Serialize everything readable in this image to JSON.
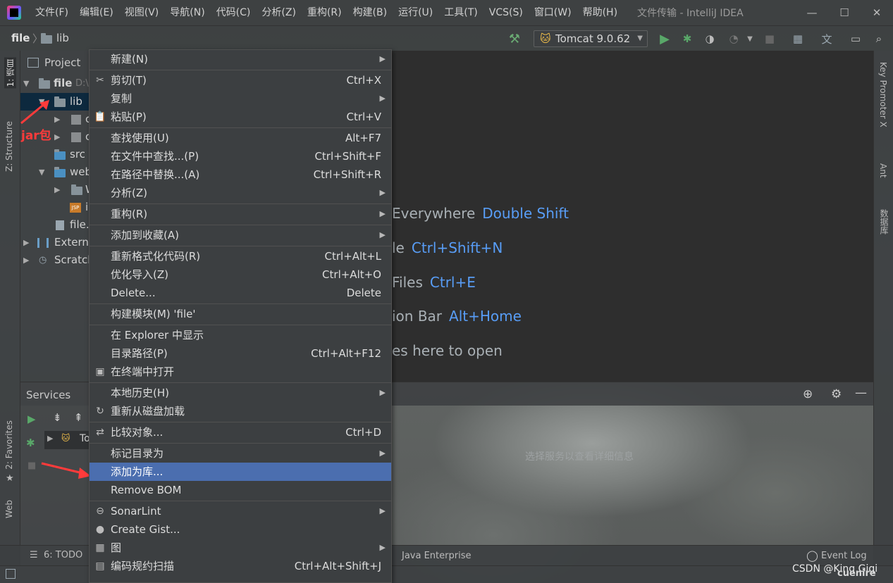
{
  "title_bar": {
    "menus": [
      "文件(F)",
      "编辑(E)",
      "视图(V)",
      "导航(N)",
      "代码(C)",
      "分析(Z)",
      "重构(R)",
      "构建(B)",
      "运行(U)",
      "工具(T)",
      "VCS(S)",
      "窗口(W)",
      "帮助(H)"
    ],
    "window_title": "文件传输 - IntelliJ IDEA",
    "minimize": "—",
    "maximize": "☐",
    "close": "✕"
  },
  "navbar": {
    "crumb_root": "file",
    "crumb_sep": "〉",
    "crumb_folder": "lib",
    "run_config": "Tomcat 9.0.62"
  },
  "left_stripe": {
    "tab_project": "1: 项目",
    "tab_structure": "Z: Structure",
    "tab_favorites": "2: Favorites",
    "tab_web": "Web"
  },
  "right_stripe": {
    "tab_key_promoter": "Key Promoter X",
    "tab_ant": "Ant",
    "tab_database": "数据库"
  },
  "project_panel": {
    "header": "Project",
    "tree": [
      {
        "label": "file",
        "extra": "D:\\"
      },
      {
        "label": "lib"
      },
      {
        "label": "c"
      },
      {
        "label": "c"
      },
      {
        "label": "src"
      },
      {
        "label": "web"
      },
      {
        "label": "W"
      },
      {
        "label": "i"
      },
      {
        "label": "file."
      },
      {
        "label": "Externa"
      },
      {
        "label": "Scratch"
      }
    ]
  },
  "editor": {
    "hints": [
      {
        "text": "Everywhere",
        "key": "Double Shift"
      },
      {
        "text": "le",
        "key": "Ctrl+Shift+N"
      },
      {
        "text": "Files",
        "key": "Ctrl+E"
      },
      {
        "text": "ion Bar",
        "key": "Alt+Home"
      },
      {
        "text": "es here to open",
        "key": ""
      }
    ]
  },
  "services": {
    "title": "Services",
    "placeholder": "选择服务以查看详细信息",
    "node": "To"
  },
  "bottom_bar": {
    "todo": "6: TODO",
    "java_enterprise": "Java Enterprise",
    "event_log": "Event Log",
    "watermark": "CSDN @King Gigi",
    "brand": "cuenire"
  },
  "annotation": {
    "label": "jar包"
  },
  "context_menu": [
    {
      "label": "新建(N)",
      "shortcut": "",
      "submenu": true,
      "icon": ""
    },
    {
      "sep": true
    },
    {
      "label": "剪切(T)",
      "shortcut": "Ctrl+X",
      "submenu": false,
      "icon": "✂"
    },
    {
      "label": "复制",
      "shortcut": "",
      "submenu": true,
      "icon": ""
    },
    {
      "label": "粘贴(P)",
      "shortcut": "Ctrl+V",
      "submenu": false,
      "icon": "📋"
    },
    {
      "sep": true
    },
    {
      "label": "查找使用(U)",
      "shortcut": "Alt+F7",
      "submenu": false,
      "icon": ""
    },
    {
      "label": "在文件中查找...(P)",
      "shortcut": "Ctrl+Shift+F",
      "submenu": false,
      "icon": ""
    },
    {
      "label": "在路径中替换...(A)",
      "shortcut": "Ctrl+Shift+R",
      "submenu": false,
      "icon": ""
    },
    {
      "label": "分析(Z)",
      "shortcut": "",
      "submenu": true,
      "icon": ""
    },
    {
      "sep": true
    },
    {
      "label": "重构(R)",
      "shortcut": "",
      "submenu": true,
      "icon": ""
    },
    {
      "sep": true
    },
    {
      "label": "添加到收藏(A)",
      "shortcut": "",
      "submenu": true,
      "icon": ""
    },
    {
      "sep": true
    },
    {
      "label": "重新格式化代码(R)",
      "shortcut": "Ctrl+Alt+L",
      "submenu": false,
      "icon": ""
    },
    {
      "label": "优化导入(Z)",
      "shortcut": "Ctrl+Alt+O",
      "submenu": false,
      "icon": ""
    },
    {
      "label": "Delete...",
      "shortcut": "Delete",
      "submenu": false,
      "icon": ""
    },
    {
      "sep": true
    },
    {
      "label": "构建模块(M) 'file'",
      "shortcut": "",
      "submenu": false,
      "icon": ""
    },
    {
      "sep": true
    },
    {
      "label": "在 Explorer 中显示",
      "shortcut": "",
      "submenu": false,
      "icon": ""
    },
    {
      "label": "目录路径(P)",
      "shortcut": "Ctrl+Alt+F12",
      "submenu": false,
      "icon": ""
    },
    {
      "label": "在终端中打开",
      "shortcut": "",
      "submenu": false,
      "icon": "▣"
    },
    {
      "sep": true
    },
    {
      "label": "本地历史(H)",
      "shortcut": "",
      "submenu": true,
      "icon": ""
    },
    {
      "label": "重新从磁盘加载",
      "shortcut": "",
      "submenu": false,
      "icon": "↻"
    },
    {
      "sep": true
    },
    {
      "label": "比较对象...",
      "shortcut": "Ctrl+D",
      "submenu": false,
      "icon": "⇄"
    },
    {
      "sep": true
    },
    {
      "label": "标记目录为",
      "shortcut": "",
      "submenu": true,
      "icon": ""
    },
    {
      "label": "添加为库...",
      "shortcut": "",
      "submenu": false,
      "icon": "",
      "selected": true
    },
    {
      "label": "Remove BOM",
      "shortcut": "",
      "submenu": false,
      "icon": ""
    },
    {
      "sep": true
    },
    {
      "label": "SonarLint",
      "shortcut": "",
      "submenu": true,
      "icon": "⊖"
    },
    {
      "label": "Create Gist...",
      "shortcut": "",
      "submenu": false,
      "icon": "●"
    },
    {
      "label": "图",
      "shortcut": "",
      "submenu": true,
      "icon": "▦"
    },
    {
      "label": "编码规约扫描",
      "shortcut": "Ctrl+Alt+Shift+J",
      "submenu": false,
      "icon": "▤"
    }
  ],
  "colors": {
    "accent": "#589df6",
    "selection": "#4b6eaf",
    "annotation": "#ff3b3b"
  }
}
